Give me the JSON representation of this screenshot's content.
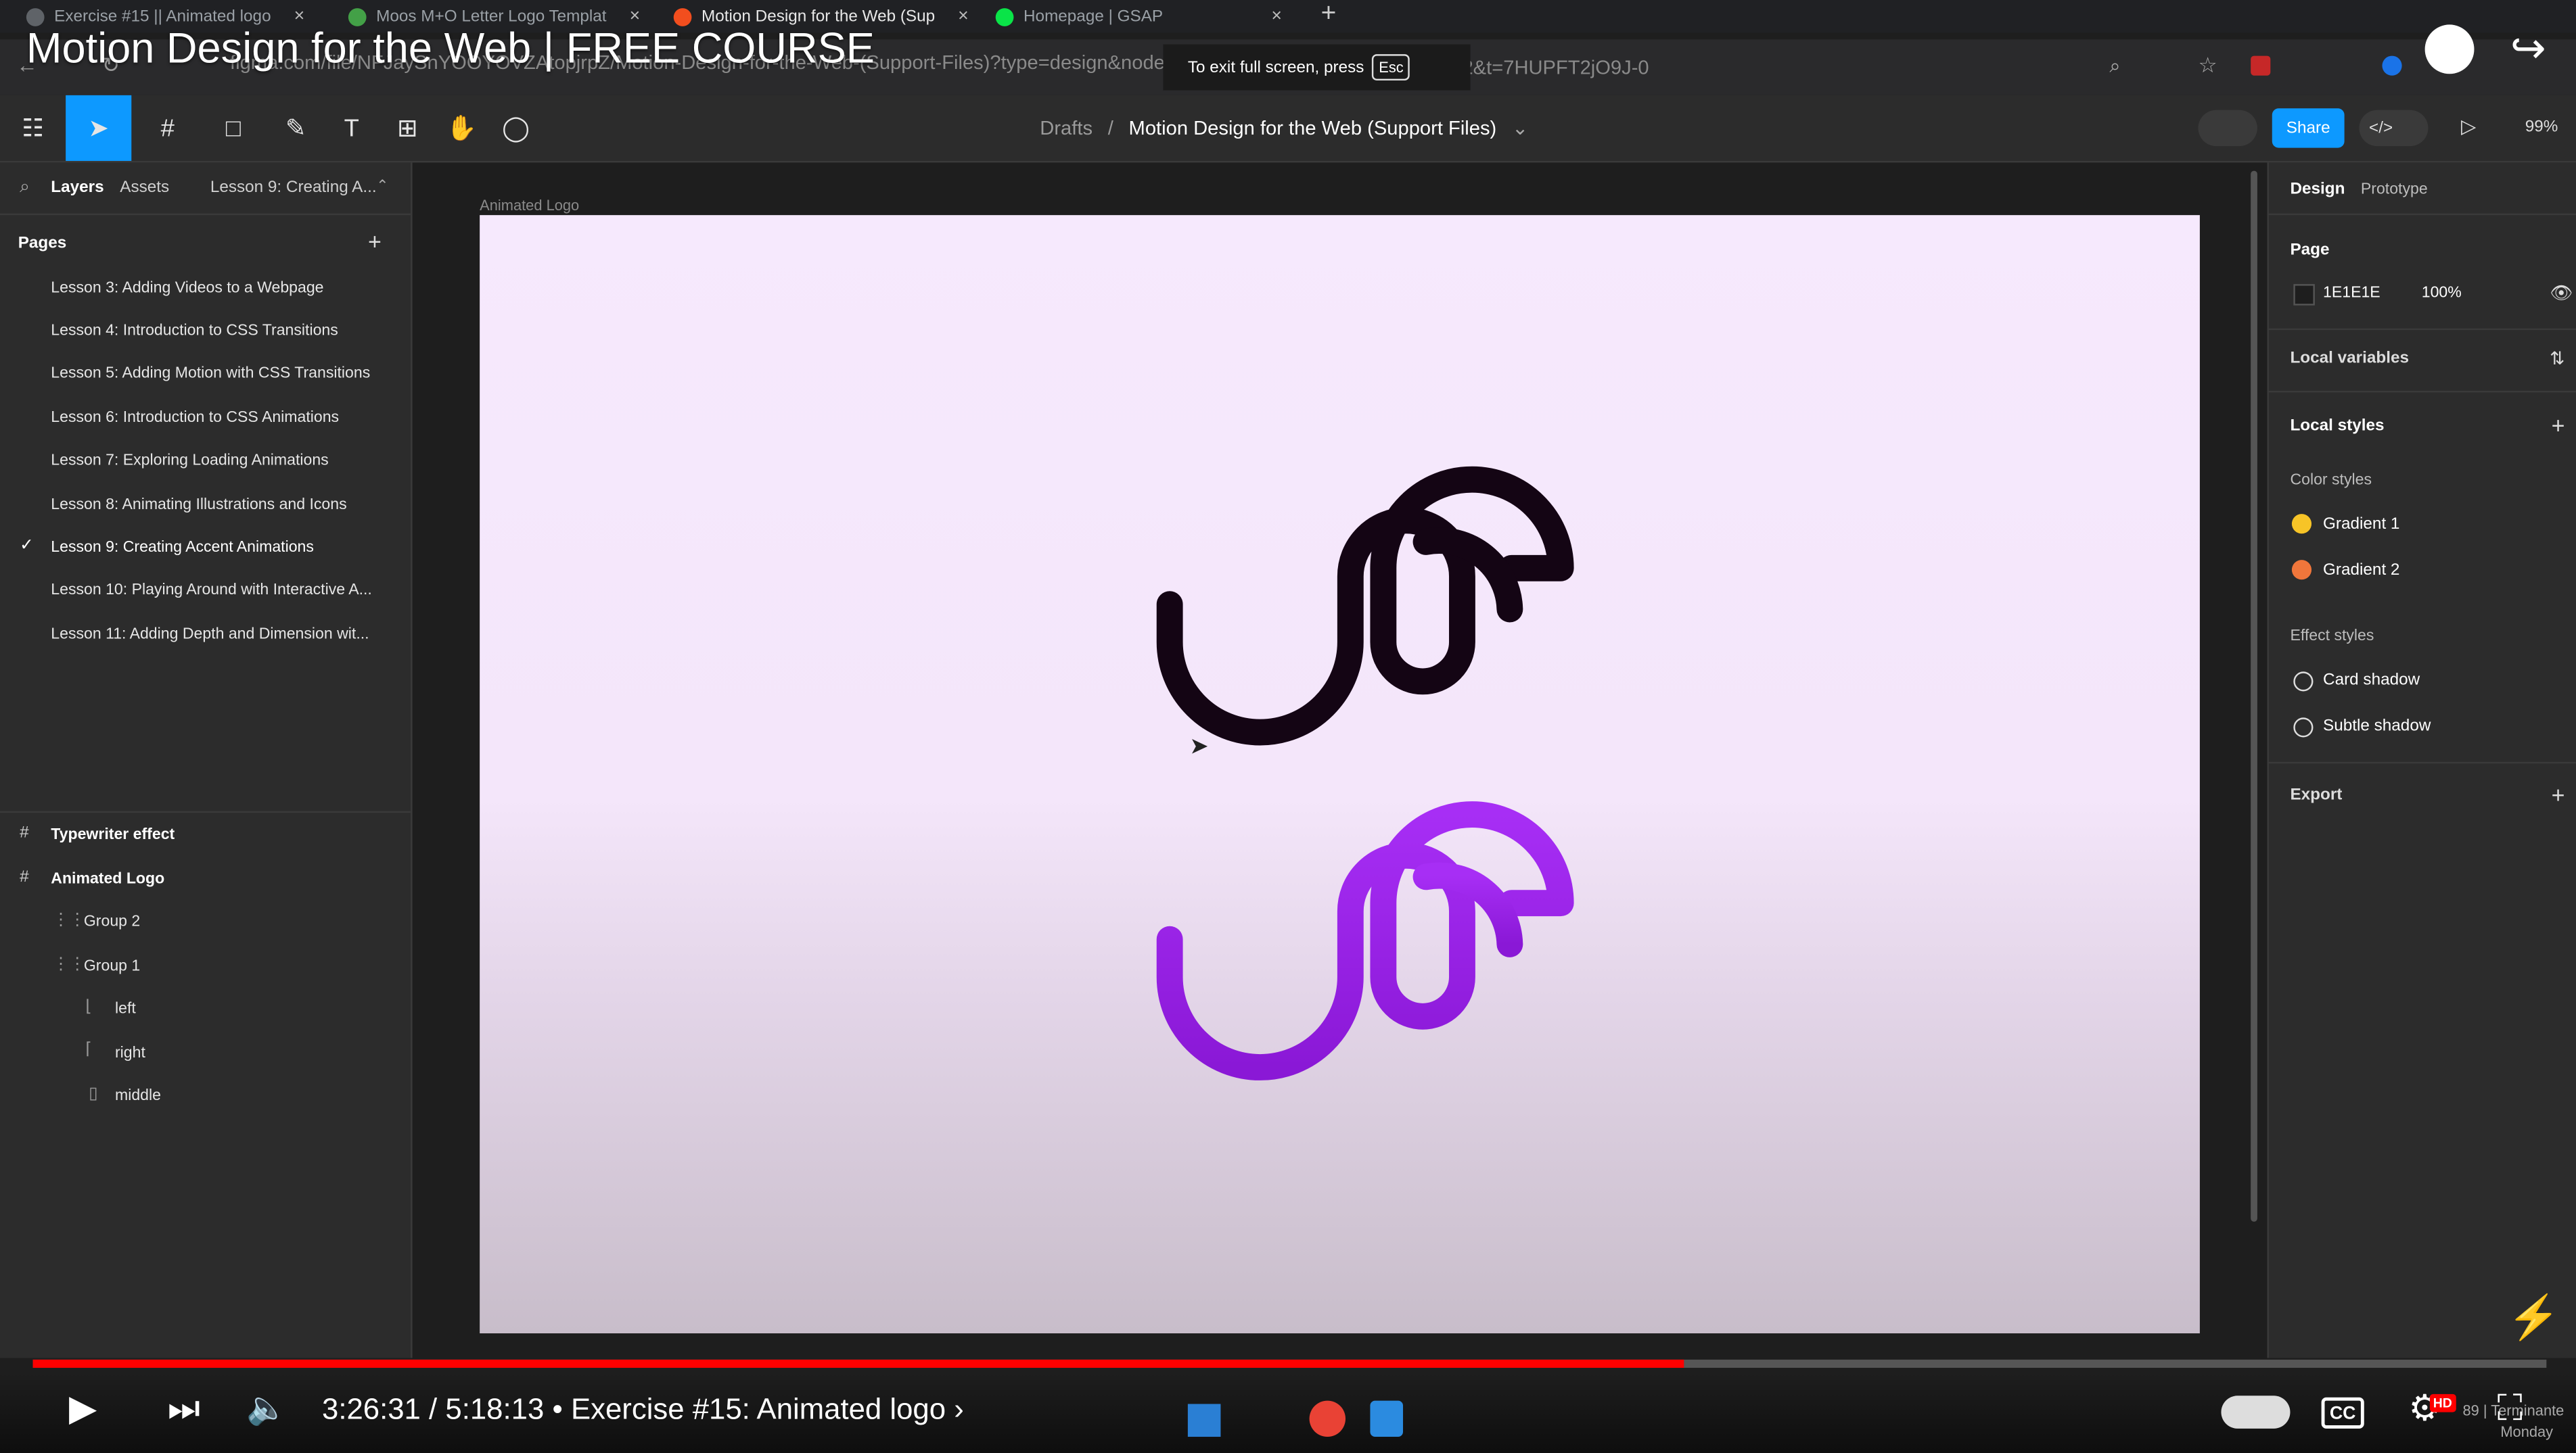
{
  "video": {
    "title": "Motion Design for the Web | FREE COURSE",
    "current_time": "3:26:31",
    "duration": "5:18:13",
    "chapter": "Exercise #15: Animated logo",
    "progress_fraction": 0.657,
    "quality_badge": "HD"
  },
  "browser": {
    "tabs": [
      {
        "label": "Exercise #15 || Animated logo",
        "icon_color": "#5f6368"
      },
      {
        "label": "Moos M+O Letter Logo Templat",
        "icon_color": "#43a047"
      },
      {
        "label": "Motion Design for the Web (Sup",
        "icon_color": "#f24e1e"
      },
      {
        "label": "Homepage | GSAP",
        "icon_color": "#0ae448"
      }
    ],
    "url": "figma.com/file/NFJaySnYOOYOVZAtopjrpZ/Motion-Design-for-the-Web-(Support-Files)?type=design&node-id=",
    "url_tail": "4:2&t=7HUPFT2jO9J-0",
    "fullscreen_msg": "To exit full screen, press",
    "esc_key": "Esc"
  },
  "figma": {
    "breadcrumb_root": "Drafts",
    "breadcrumb_sep": "/",
    "file_name": "Motion Design for the Web (Support Files)",
    "share_label": "Share",
    "zoom": "99%",
    "left_tabs": {
      "layers": "Layers",
      "assets": "Assets",
      "current_page": "Lesson 9: Creating A..."
    },
    "pages_heading": "Pages",
    "pages": [
      "Lesson 3: Adding Videos to a Webpage",
      "Lesson 4: Introduction to CSS Transitions",
      "Lesson 5: Adding Motion with CSS Transitions",
      "Lesson 6: Introduction to CSS Animations",
      "Lesson 7: Exploring Loading Animations",
      "Lesson 8: Animating Illustrations and Icons",
      "Lesson 9: Creating Accent Animations",
      "Lesson 10: Playing Around with Interactive A...",
      "Lesson 11: Adding Depth and Dimension wit..."
    ],
    "layers": {
      "frame1": "Typewriter effect",
      "frame2": "Animated Logo",
      "group2": "Group 2",
      "group1": "Group 1",
      "left": "left",
      "right": "right",
      "middle": "middle"
    },
    "frame_label": "Animated Logo",
    "logo_colors": {
      "dark": "#140514",
      "purple_top": "#a72ef5",
      "purple_bottom": "#8a18d6"
    },
    "right_tabs": {
      "design": "Design",
      "prototype": "Prototype"
    },
    "page_section": {
      "heading": "Page",
      "color_hex": "1E1E1E",
      "opacity": "100%"
    },
    "local_variables": "Local variables",
    "local_styles": "Local styles",
    "color_styles_heading": "Color styles",
    "color_styles": [
      {
        "name": "Gradient 1",
        "color": "#f7c427"
      },
      {
        "name": "Gradient 2",
        "color": "#f0763b"
      }
    ],
    "effect_styles_heading": "Effect styles",
    "effect_styles": [
      "Card shadow",
      "Subtle shadow"
    ],
    "export_label": "Export"
  },
  "taskbar": {
    "clock_line1": "89 | Terminante",
    "clock_line2": "Monday"
  }
}
